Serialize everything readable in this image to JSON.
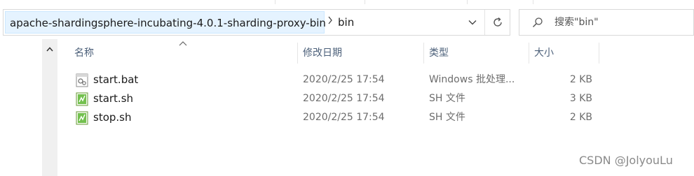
{
  "address_bar": {
    "crumbs": [
      "apache-shardingsphere-incubating-4.0.1-sharding-proxy-bin",
      "bin"
    ]
  },
  "search": {
    "placeholder": "搜索\"bin\""
  },
  "columns": {
    "name": "名称",
    "date": "修改日期",
    "type": "类型",
    "size": "大小"
  },
  "files": [
    {
      "name": "start.bat",
      "date": "2020/2/25 17:54",
      "type": "Windows 批处理...",
      "size": "2 KB",
      "icon": "batch-file-icon"
    },
    {
      "name": "start.sh",
      "date": "2020/2/25 17:54",
      "type": "SH 文件",
      "size": "3 KB",
      "icon": "sh-file-icon"
    },
    {
      "name": "stop.sh",
      "date": "2020/2/25 17:54",
      "type": "SH 文件",
      "size": "2 KB",
      "icon": "sh-file-icon"
    }
  ],
  "watermark": "CSDN @JolyouLu",
  "colors": {
    "crumb_highlight": "#e5f3ff",
    "header_text": "#4c607a",
    "sh_icon_green": "#5cb531"
  }
}
